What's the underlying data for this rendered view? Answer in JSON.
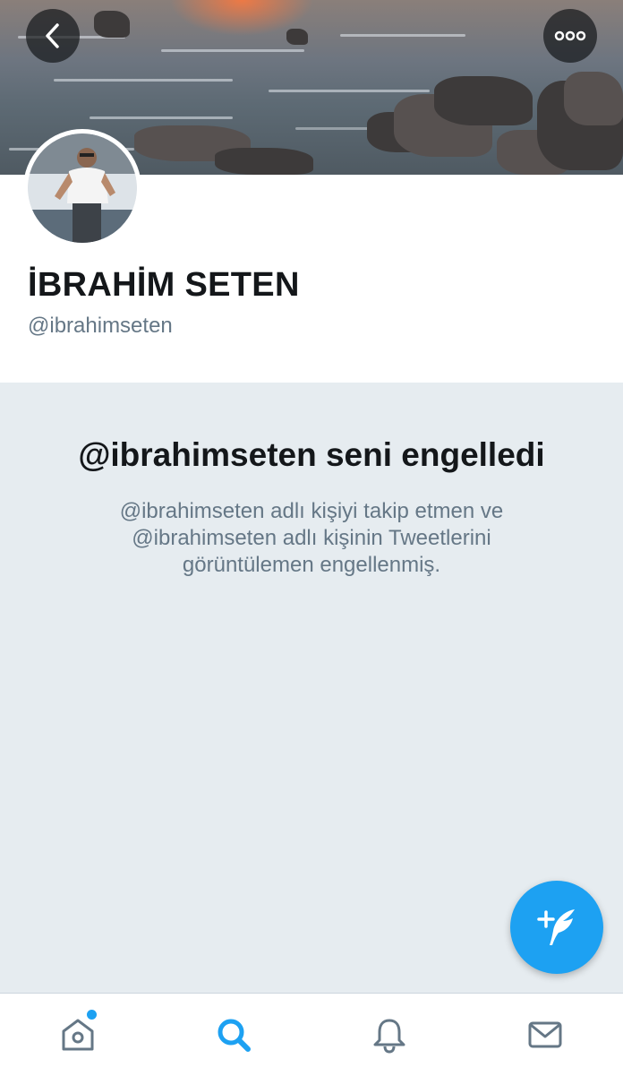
{
  "banner": {
    "back_icon": "chevron-left-icon",
    "more_icon": "more-horizontal-icon"
  },
  "profile": {
    "name": "İBRAHİM SETEN",
    "handle": "@ibrahimseten"
  },
  "blocked": {
    "title": "@ibrahimseten seni engelledi",
    "message": "@ibrahimseten adlı kişiyi takip etmen ve @ibrahimseten adlı kişinin Tweetlerini görüntülemen engellenmiş."
  },
  "fab": {
    "icon": "compose-tweet-icon"
  },
  "tabbar": {
    "items": [
      {
        "icon": "home-icon",
        "active": false,
        "has_notification_dot": true
      },
      {
        "icon": "search-icon",
        "active": true
      },
      {
        "icon": "notifications-bell-icon",
        "active": false
      },
      {
        "icon": "messages-envelope-icon",
        "active": false
      }
    ]
  },
  "colors": {
    "accent": "#1da1f2",
    "text_primary": "#14171a",
    "text_secondary": "#657786",
    "background": "#e6ecf0",
    "icon_inactive": "#657786"
  }
}
